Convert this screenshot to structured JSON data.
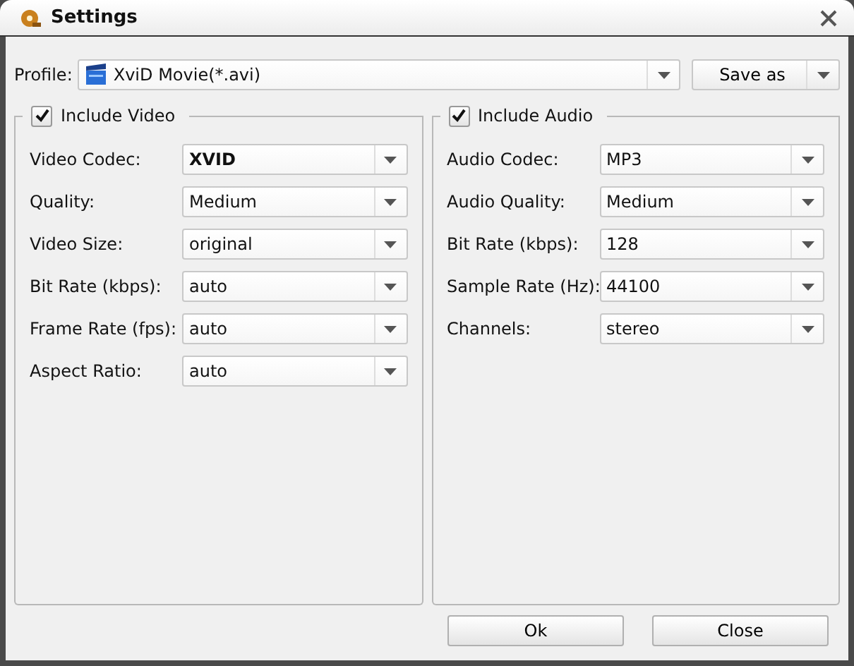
{
  "window": {
    "title": "Settings"
  },
  "profile": {
    "label": "Profile:",
    "value": "XviD Movie(*.avi)"
  },
  "save_as": {
    "label": "Save as"
  },
  "groups": [
    {
      "title": "Include Video",
      "checked": true,
      "fields": [
        {
          "label": "Video Codec:",
          "value": "XVID",
          "bold": true
        },
        {
          "label": "Quality:",
          "value": "Medium",
          "bold": false
        },
        {
          "label": "Video Size:",
          "value": "original",
          "bold": false
        },
        {
          "label": "Bit Rate (kbps):",
          "value": "auto",
          "bold": false
        },
        {
          "label": "Frame Rate (fps):",
          "value": "auto",
          "bold": false
        },
        {
          "label": "Aspect Ratio:",
          "value": "auto",
          "bold": false
        }
      ]
    },
    {
      "title": "Include Audio",
      "checked": true,
      "fields": [
        {
          "label": "Audio Codec:",
          "value": "MP3",
          "bold": false
        },
        {
          "label": "Audio Quality:",
          "value": "Medium",
          "bold": false
        },
        {
          "label": "Bit Rate (kbps):",
          "value": "128",
          "bold": false
        },
        {
          "label": "Sample Rate (Hz):",
          "value": "44100",
          "bold": false
        },
        {
          "label": "Channels:",
          "value": "stereo",
          "bold": false
        }
      ]
    }
  ],
  "buttons": [
    "Ok",
    "Close"
  ]
}
